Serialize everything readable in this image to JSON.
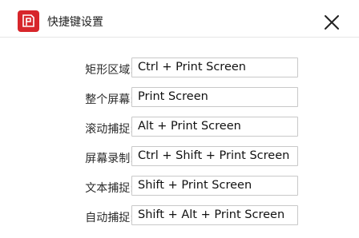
{
  "window": {
    "title": "快捷键设置",
    "app_icon": "app-logo-icon",
    "close_icon": "close-icon",
    "accent_color": "#d7262b"
  },
  "shortcuts": [
    {
      "label": "矩形区域:",
      "value": "Ctrl + Print Screen"
    },
    {
      "label": "整个屏幕:",
      "value": "Print Screen"
    },
    {
      "label": "滚动捕捉:",
      "value": "Alt + Print Screen"
    },
    {
      "label": "屏幕录制:",
      "value": "Ctrl + Shift + Print Screen"
    },
    {
      "label": "文本捕捉:",
      "value": "Shift + Print Screen"
    },
    {
      "label": "自动捕捉:",
      "value": "Shift + Alt + Print Screen"
    }
  ]
}
